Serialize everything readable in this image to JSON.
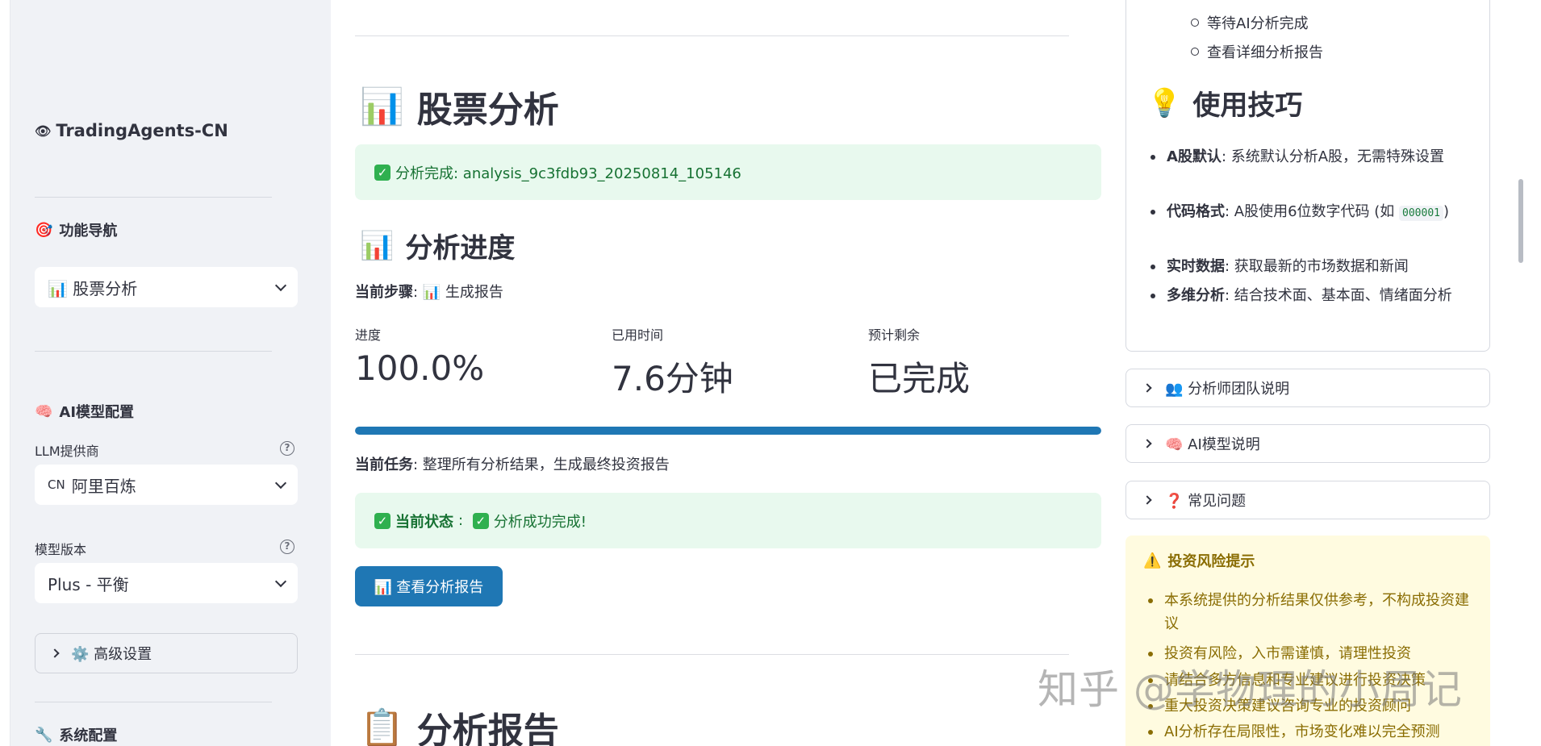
{
  "sidebar": {
    "brand": "TradingAgents-CN",
    "nav_heading": "功能导航",
    "nav_select": "📊 股票分析",
    "ai_heading": "AI模型配置",
    "llm_label": "LLM提供商",
    "llm_prefix": "CN",
    "llm_value": "阿里百炼",
    "model_label": "模型版本",
    "model_value": "Plus - 平衡",
    "advanced_label": "⚙️ 高级设置",
    "sys_heading": "系统配置"
  },
  "main": {
    "title": "股票分析",
    "success_msg": "分析完成: analysis_9c3fdb93_20250814_105146",
    "progress_title": "分析进度",
    "current_step_label": "当前步骤",
    "current_step_value": "📊 生成报告",
    "metrics": [
      {
        "label": "进度",
        "value": "100.0%"
      },
      {
        "label": "已用时间",
        "value": "7.6分钟"
      },
      {
        "label": "预计剩余",
        "value": "已完成"
      }
    ],
    "progress": 1.0,
    "current_task_label": "当前任务",
    "current_task_value": "整理所有分析结果，生成最终投资报告",
    "status_label": "当前状态",
    "status_value": "分析成功完成!",
    "view_report_button": "📊 查看分析报告",
    "report_title": "分析报告"
  },
  "right": {
    "steps": [
      "等待AI分析完成",
      "查看详细分析报告"
    ],
    "tips_title": "使用技巧",
    "tips": [
      {
        "bold": "A股默认",
        "text": ": 系统默认分析A股，无需特殊设置"
      },
      {
        "bold": "代码格式",
        "text": ": A股使用6位数字代码 (如 ",
        "code": "000001",
        "tail": ")"
      },
      {
        "bold": "实时数据",
        "text": ": 获取最新的市场数据和新闻"
      },
      {
        "bold": "多维分析",
        "text": ": 结合技术面、基本面、情绪面分析"
      }
    ],
    "expanders": [
      "👥 分析师团队说明",
      "🧠 AI模型说明",
      "❓ 常见问题"
    ],
    "risk_title": "投资风险提示",
    "risk_items": [
      "本系统提供的分析结果仅供参考，不构成投资建议",
      "投资有风险，入市需谨慎，请理性投资",
      "请结合多方信息和专业建议进行投资决策",
      "重大投资决策建议咨询专业的投资顾问",
      "AI分析存在局限性，市场变化难以完全预测"
    ]
  },
  "watermark": "知乎 @学物理的小周记",
  "colors": {
    "primary": "#1f77b4",
    "success_bg": "#e8f9ee",
    "success_text": "#177233",
    "warning_bg": "#fffbe0",
    "warning_text": "#8a6d03"
  }
}
